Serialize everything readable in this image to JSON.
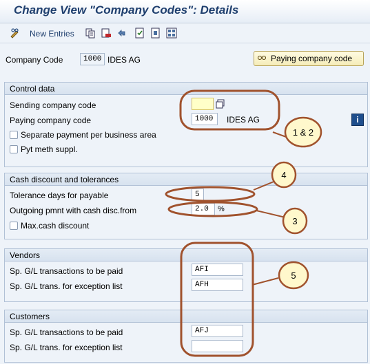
{
  "title": "Change View \"Company Codes\": Details",
  "toolbar": {
    "new_entries": "New Entries"
  },
  "header": {
    "company_code_label": "Company Code",
    "company_code_value": "1000",
    "company_name": "IDES AG",
    "paying_button": "Paying company code"
  },
  "control": {
    "title": "Control data",
    "sending_label": "Sending company code",
    "sending_value": "",
    "paying_label": "Paying company code",
    "paying_value": "1000",
    "paying_name": "IDES AG",
    "separate_label": "Separate payment per business area",
    "pyt_label": "Pyt meth suppl."
  },
  "cash": {
    "title": "Cash discount and tolerances",
    "tolerance_label": "Tolerance days for payable",
    "tolerance_value": "5",
    "outgoing_label": "Outgoing pmnt with cash disc.from",
    "outgoing_value": "2.0",
    "percent": "%",
    "max_label": "Max.cash discount"
  },
  "vendors": {
    "title": "Vendors",
    "sp_paid_label": "Sp. G/L transactions to be paid",
    "sp_paid_value": "AFI",
    "sp_exc_label": "Sp. G/L trans. for exception list",
    "sp_exc_value": "AFH"
  },
  "customers": {
    "title": "Customers",
    "sp_paid_label": "Sp. G/L transactions to be paid",
    "sp_paid_value": "AFJ",
    "sp_exc_label": "Sp. G/L trans. for exception list",
    "sp_exc_value": ""
  },
  "callouts": {
    "c12": "1 & 2",
    "c4": "4",
    "c3": "3",
    "c5": "5"
  },
  "icons": [
    "pencil-glasses-icon",
    "copy-icon",
    "delete-icon",
    "undo-icon",
    "select-all-icon",
    "deselect-icon",
    "block-icon",
    "info-icon"
  ],
  "colors": {
    "title": "#1f3f6e",
    "callout_ring": "#a0522d",
    "callout_fill": "#fff8cc",
    "focus_field": "#ffffc8"
  }
}
